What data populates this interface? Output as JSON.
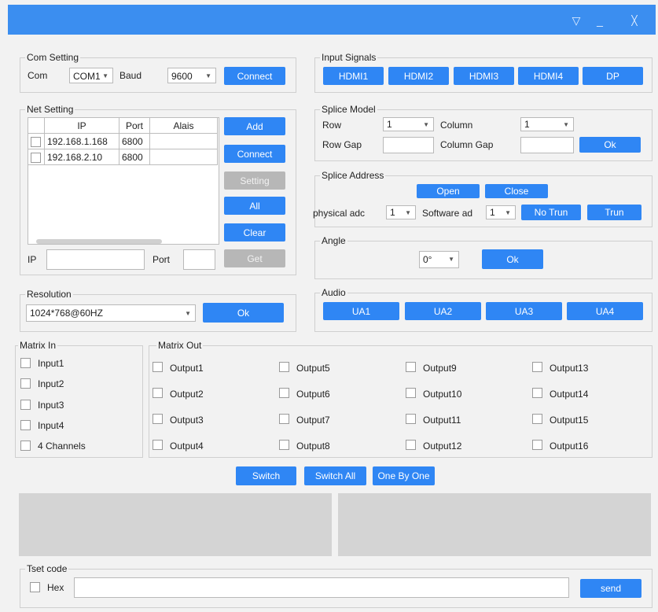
{
  "window": {
    "minimize_glyph": "_",
    "close_glyph": "╳",
    "menu_glyph": "▽"
  },
  "com": {
    "title": "Com Setting",
    "com_label": "Com",
    "com_value": "COM1",
    "baud_label": "Baud",
    "baud_value": "9600",
    "connect_label": "Connect"
  },
  "net": {
    "title": "Net Setting",
    "headers": [
      "IP",
      "Port",
      "Alais"
    ],
    "rows": [
      {
        "ip": "192.168.1.168",
        "port": "6800",
        "alias": ""
      },
      {
        "ip": "192.168.2.10",
        "port": "6800",
        "alias": ""
      }
    ],
    "buttons": {
      "add": "Add",
      "connect": "Connect",
      "setting": "Setting",
      "all": "All",
      "clear": "Clear",
      "get": "Get"
    },
    "ip_label": "IP",
    "port_label": "Port"
  },
  "resolution": {
    "title": "Resolution",
    "value": "1024*768@60HZ",
    "ok": "Ok"
  },
  "input_signals": {
    "title": "Input Signals",
    "buttons": [
      "HDMI1",
      "HDMI2",
      "HDMI3",
      "HDMI4",
      "DP"
    ]
  },
  "splice_model": {
    "title": "Splice Model",
    "row_label": "Row",
    "row_value": "1",
    "column_label": "Column",
    "column_value": "1",
    "row_gap_label": "Row Gap",
    "column_gap_label": "Column Gap",
    "ok": "Ok"
  },
  "splice_address": {
    "title": "Splice Address",
    "open": "Open",
    "close": "Close",
    "physical_label": "physical adc",
    "physical_value": "1",
    "software_label": "Software ad",
    "software_value": "1",
    "no_trun": "No Trun",
    "trun": "Trun"
  },
  "angle": {
    "title": "Angle",
    "value": "0°",
    "ok": "Ok"
  },
  "audio": {
    "title": "Audio",
    "buttons": [
      "UA1",
      "UA2",
      "UA3",
      "UA4"
    ]
  },
  "matrix_in": {
    "title": "Matrix In",
    "items": [
      "Input1",
      "Input2",
      "Input3",
      "Input4",
      "4 Channels"
    ]
  },
  "matrix_out": {
    "title": "Matrix Out",
    "items": [
      "Output1",
      "Output2",
      "Output3",
      "Output4",
      "Output5",
      "Output6",
      "Output7",
      "Output8",
      "Output9",
      "Output10",
      "Output11",
      "Output12",
      "Output13",
      "Output14",
      "Output15",
      "Output16"
    ]
  },
  "actions": {
    "switch": "Switch",
    "switch_all": "Switch All",
    "one_by_one": "One By One"
  },
  "test_code": {
    "title": "Tset code",
    "hex_label": "Hex",
    "send": "send"
  },
  "colors": {
    "accent": "#2f86f4",
    "title_bar": "#3b8ef0",
    "disabled": "#b7b7b7"
  }
}
